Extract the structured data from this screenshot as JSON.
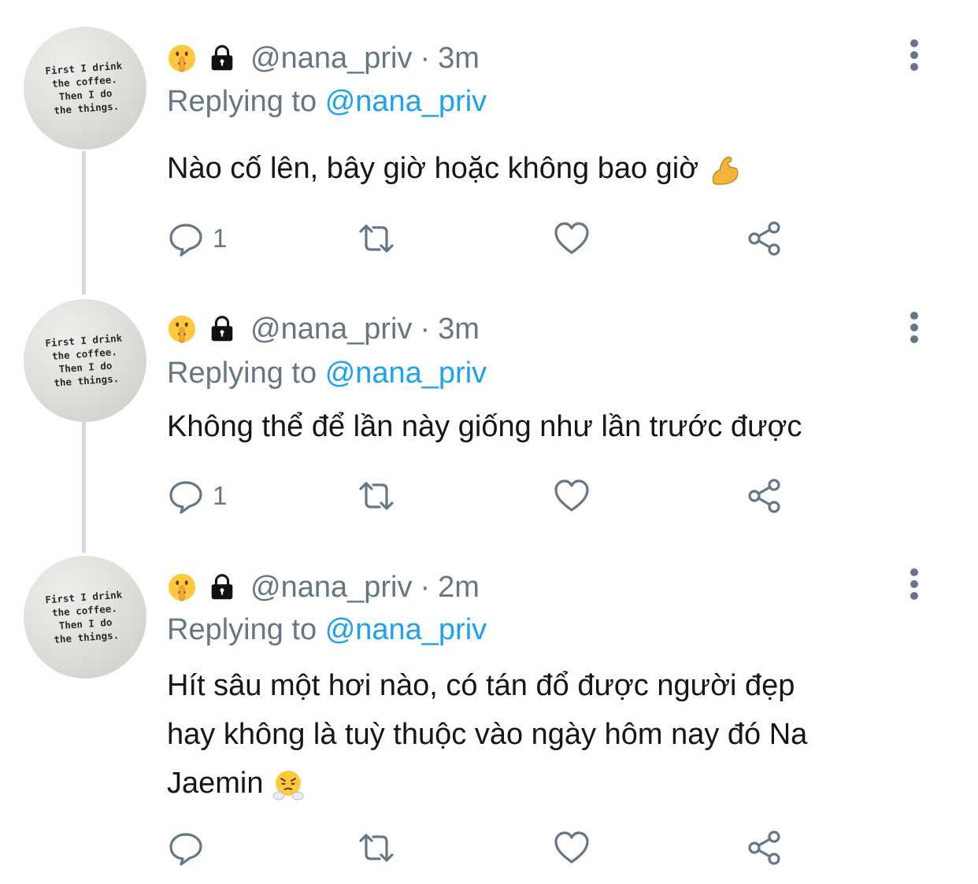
{
  "tweets": [
    {
      "avatar_lines": [
        "First I drink",
        "the coffee.",
        "Then I do",
        "the things."
      ],
      "handle": "@nana_priv",
      "separator": "·",
      "time": "3m",
      "replying_prefix": "Replying to",
      "replying_to": "@nana_priv",
      "text": "Nào cố lên, bây giờ hoặc không bao giờ",
      "trailing_emoji": "flexed-biceps",
      "reply_count": "1"
    },
    {
      "avatar_lines": [
        "First I drink",
        "the coffee.",
        "Then I do",
        "the things."
      ],
      "handle": "@nana_priv",
      "separator": "·",
      "time": "3m",
      "replying_prefix": "Replying to",
      "replying_to": "@nana_priv",
      "text": "Không thể để lần này giống như lần trước được",
      "trailing_emoji": "",
      "reply_count": "1"
    },
    {
      "avatar_lines": [
        "First I drink",
        "the coffee.",
        "Then I do",
        "the things."
      ],
      "handle": "@nana_priv",
      "separator": "·",
      "time": "2m",
      "replying_prefix": "Replying to",
      "replying_to": "@nana_priv",
      "text_lines": [
        "Hít sâu một hơi nào, có tán đổ được người đẹp",
        "hay không là tuỳ thuộc vào ngày hôm nay đó Na",
        "Jaemin"
      ],
      "trailing_emoji": "face-with-steam-from-nose",
      "reply_count": ""
    }
  ],
  "icons": {
    "name_emoji": "shushing-face",
    "protected": "lock-icon",
    "more": "more-vertical-icon",
    "reply": "reply-icon",
    "retweet": "retweet-icon",
    "like": "heart-icon",
    "share": "share-icon"
  },
  "colors": {
    "secondary_text": "#657786",
    "link": "#1da1f2",
    "thread_line": "#cfd9de"
  }
}
